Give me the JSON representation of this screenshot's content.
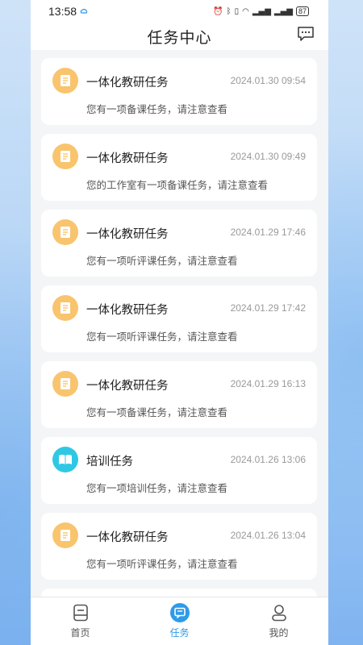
{
  "status": {
    "time": "13:58",
    "battery": "87"
  },
  "header": {
    "title": "任务中心"
  },
  "tasks": [
    {
      "title": "一体化教研任务",
      "time": "2024.01.30 09:54",
      "desc": "您有一项备课任务，请注意查看",
      "icon": "document-icon"
    },
    {
      "title": "一体化教研任务",
      "time": "2024.01.30 09:49",
      "desc": "您的工作室有一项备课任务，请注意查看",
      "icon": "document-icon"
    },
    {
      "title": "一体化教研任务",
      "time": "2024.01.29 17:46",
      "desc": "您有一项听评课任务，请注意查看",
      "icon": "document-icon"
    },
    {
      "title": "一体化教研任务",
      "time": "2024.01.29 17:42",
      "desc": "您有一项听评课任务，请注意查看",
      "icon": "document-icon"
    },
    {
      "title": "一体化教研任务",
      "time": "2024.01.29 16:13",
      "desc": "您有一项备课任务，请注意查看",
      "icon": "document-icon"
    },
    {
      "title": "培训任务",
      "time": "2024.01.26 13:06",
      "desc": "您有一项培训任务，请注意查看",
      "icon": "book-icon"
    },
    {
      "title": "一体化教研任务",
      "time": "2024.01.26 13:04",
      "desc": "您有一项听评课任务，请注意查看",
      "icon": "document-icon"
    }
  ],
  "tabbar": {
    "home": "首页",
    "tasks": "任务",
    "mine": "我的",
    "active": "tasks"
  },
  "colors": {
    "accent": "#2f9be8",
    "task_icon_orange": "#f9c46e",
    "task_icon_cyan": "#2fc8e4"
  }
}
